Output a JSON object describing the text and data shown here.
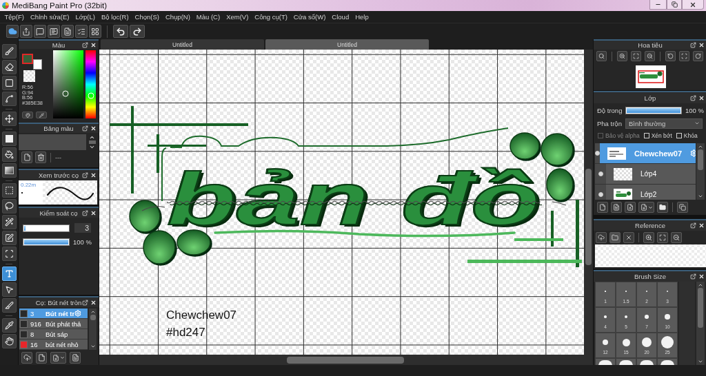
{
  "window": {
    "title": "MediBang Paint Pro (32bit)"
  },
  "menu": [
    "Tệp(F)",
    "Chỉnh sửa(E)",
    "Lớp(L)",
    "Bộ lọc(R)",
    "Chọn(S)",
    "Chụp(N)",
    "Màu (C)",
    "Xem(V)",
    "Công cụ(T)",
    "Cửa sổ(W)",
    "Cloud",
    "Help"
  ],
  "tool_groups": [
    [
      {
        "kind": "brush",
        "selected": false
      },
      {
        "kind": "eraser",
        "selected": false
      },
      {
        "kind": "dot",
        "selected": false
      },
      {
        "kind": "polyline",
        "selected": false
      }
    ],
    [
      {
        "kind": "move",
        "selected": false
      }
    ],
    [
      {
        "kind": "fill",
        "selected": false
      },
      {
        "kind": "bucket",
        "selected": false
      },
      {
        "kind": "gradient",
        "selected": false
      }
    ],
    [
      {
        "kind": "select",
        "selected": false
      },
      {
        "kind": "lasso",
        "selected": false
      },
      {
        "kind": "wand",
        "selected": false
      },
      {
        "kind": "select_pen",
        "selected": false
      },
      {
        "kind": "select_eraser",
        "selected": false
      }
    ],
    [
      {
        "kind": "text",
        "selected": true
      },
      {
        "kind": "operation",
        "selected": false
      },
      {
        "kind": "divide",
        "selected": false
      }
    ],
    [
      {
        "kind": "eyedropper",
        "selected": false
      },
      {
        "kind": "hand",
        "selected": false
      }
    ]
  ],
  "color_panel": {
    "title": "Màu",
    "swatches": [
      {
        "color": "#385e38",
        "selected": true
      },
      {
        "color": "#ffffff",
        "selected": false
      }
    ],
    "readouts": [
      "R:56",
      "G:94",
      "B:56",
      "#385E38"
    ]
  },
  "palette_panel": {
    "title": "Bảng màu",
    "palette_name": "---"
  },
  "preview_panel": {
    "title": "Xem trước cọ",
    "size_label": "0.22m"
  },
  "brush_control": {
    "title": "Kiểm soát cọ",
    "size": {
      "level": 0.03,
      "value": "3"
    },
    "opacity": {
      "level": 1,
      "reading": "100 %"
    }
  },
  "brush_panel": {
    "title": "Cọ: Bút nét tròn",
    "brushes": [
      {
        "color": "#2a2a2a",
        "size": "3",
        "name": "Bút nét tr",
        "selected": true
      },
      {
        "color": "#2a2a2a",
        "size": "916",
        "name": "Bút phát thả",
        "selected": false
      },
      {
        "color": "#2a2a2a",
        "size": "8",
        "name": "Bút sáp",
        "selected": false
      },
      {
        "color": "#e8262a",
        "size": "16",
        "name": "bút nét nhỏ",
        "selected": false
      }
    ]
  },
  "document_tabs": [
    {
      "label": "Untitled",
      "selected": false
    },
    {
      "label": "Untitled",
      "selected": true
    }
  ],
  "canvas": {
    "lettering": "bản đồ",
    "signature": [
      "Chewchew07",
      "#hd247"
    ]
  },
  "navigator": {
    "title": "Hoa tiêu"
  },
  "layers_panel": {
    "title": "Lớp",
    "opacity": {
      "label": "Độ trong",
      "level": 1,
      "reading": "100 %"
    },
    "blend": {
      "label": "Pha trộn",
      "value": "Bình thường"
    },
    "options": [
      {
        "label": "Bảo vệ alpha",
        "checked": false,
        "disabled": true
      },
      {
        "label": "Xén bớt",
        "checked": false,
        "disabled": false
      },
      {
        "label": "Khóa",
        "checked": false,
        "disabled": false
      }
    ],
    "items": [
      {
        "name": "Chewchew07",
        "kind": "text",
        "visible": true,
        "selected": true
      },
      {
        "name": "Lớp4",
        "kind": "empty",
        "visible": true,
        "selected": false
      },
      {
        "name": "Lớp2",
        "kind": "artwork",
        "visible": true,
        "selected": false
      }
    ]
  },
  "reference_panel": {
    "title": "Reference"
  },
  "brush_size_panel": {
    "title": "Brush Size",
    "sizes": [
      "1",
      "1.5",
      "2",
      "3",
      "4",
      "5",
      "7",
      "10",
      "12",
      "15",
      "20",
      "25"
    ]
  }
}
